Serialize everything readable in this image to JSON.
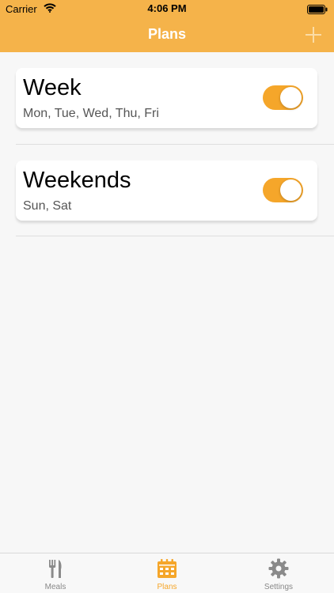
{
  "status_bar": {
    "carrier": "Carrier",
    "time": "4:06 PM"
  },
  "header": {
    "title": "Plans",
    "add_icon": "plus-icon"
  },
  "plans": [
    {
      "title": "Week",
      "days": "Mon, Tue, Wed, Thu, Fri",
      "enabled": true
    },
    {
      "title": "Weekends",
      "days": "Sun, Sat",
      "enabled": true
    }
  ],
  "tabs": [
    {
      "label": "Meals",
      "icon": "fork-knife-icon",
      "active": false
    },
    {
      "label": "Plans",
      "icon": "calendar-icon",
      "active": true
    },
    {
      "label": "Settings",
      "icon": "gear-icon",
      "active": false
    }
  ],
  "colors": {
    "accent": "#f5b34a",
    "toggle_on": "#f5a62a",
    "tab_inactive": "#888888"
  }
}
